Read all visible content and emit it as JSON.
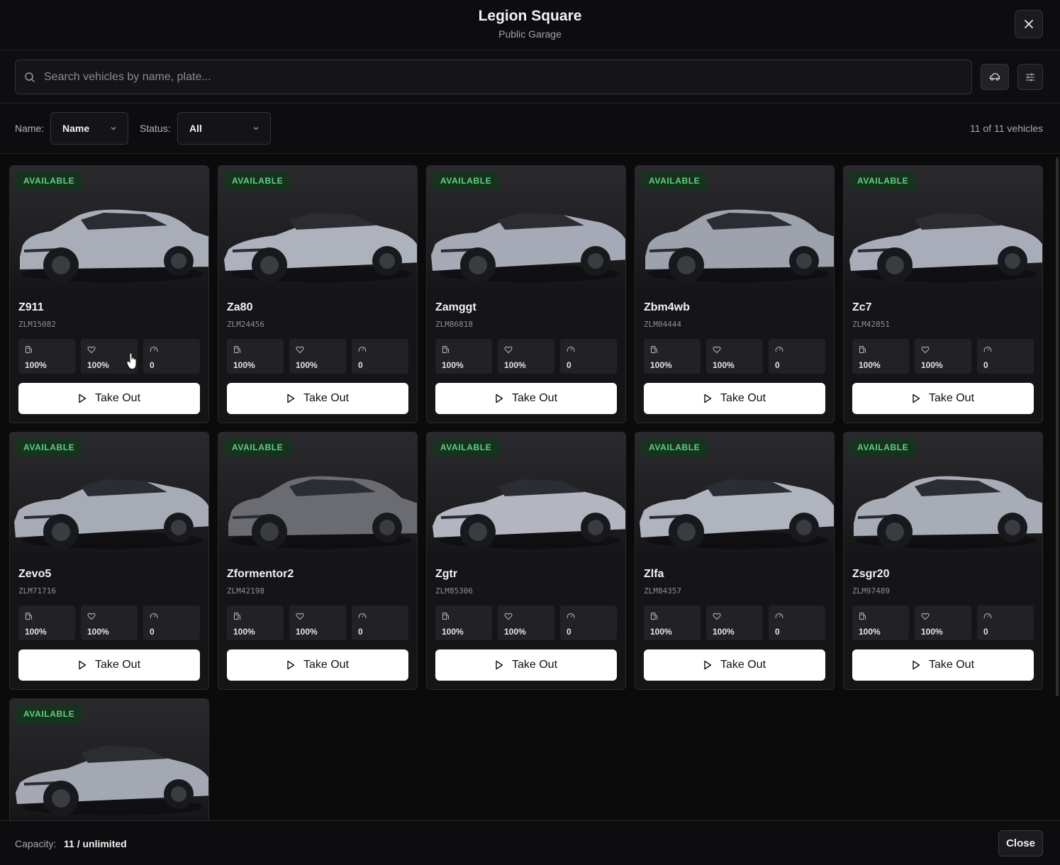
{
  "header": {
    "title": "Legion Square",
    "subtitle": "Public Garage"
  },
  "search": {
    "placeholder": "Search vehicles by name, plate..."
  },
  "filters": {
    "sort_label": "Name:",
    "sort_value": "Name",
    "status_label": "Status:",
    "status_value": "All",
    "count_text": "11 of 11 vehicles"
  },
  "vehicles": [
    {
      "name": "Z911",
      "plate": "ZLM15082",
      "status": "AVAILABLE",
      "fuel": "100%",
      "engine": "100%",
      "mileage": "0",
      "action": "Take Out",
      "paint": "#a9adb8"
    },
    {
      "name": "Za80",
      "plate": "ZLM24456",
      "status": "AVAILABLE",
      "fuel": "100%",
      "engine": "100%",
      "mileage": "0",
      "action": "Take Out",
      "paint": "#aeb2bd"
    },
    {
      "name": "Zamggt",
      "plate": "ZLM86818",
      "status": "AVAILABLE",
      "fuel": "100%",
      "engine": "100%",
      "mileage": "0",
      "action": "Take Out",
      "paint": "#a6aab6"
    },
    {
      "name": "Zbm4wb",
      "plate": "ZLM04444",
      "status": "AVAILABLE",
      "fuel": "100%",
      "engine": "100%",
      "mileage": "0",
      "action": "Take Out",
      "paint": "#9ea2ad"
    },
    {
      "name": "Zc7",
      "plate": "ZLM42851",
      "status": "AVAILABLE",
      "fuel": "100%",
      "engine": "100%",
      "mileage": "0",
      "action": "Take Out",
      "paint": "#a9adb9"
    },
    {
      "name": "Zevo5",
      "plate": "ZLM71716",
      "status": "AVAILABLE",
      "fuel": "100%",
      "engine": "100%",
      "mileage": "0",
      "action": "Take Out",
      "paint": "#a7abb6"
    },
    {
      "name": "Zformentor2",
      "plate": "ZLM42198",
      "status": "AVAILABLE",
      "fuel": "100%",
      "engine": "100%",
      "mileage": "0",
      "action": "Take Out",
      "paint": "#6a6c72"
    },
    {
      "name": "Zgtr",
      "plate": "ZLM85306",
      "status": "AVAILABLE",
      "fuel": "100%",
      "engine": "100%",
      "mileage": "0",
      "action": "Take Out",
      "paint": "#b3b6c0"
    },
    {
      "name": "Zlfa",
      "plate": "ZLM84357",
      "status": "AVAILABLE",
      "fuel": "100%",
      "engine": "100%",
      "mileage": "0",
      "action": "Take Out",
      "paint": "#b0b4be"
    },
    {
      "name": "Zsgr20",
      "plate": "ZLM97489",
      "status": "AVAILABLE",
      "fuel": "100%",
      "engine": "100%",
      "mileage": "0",
      "action": "Take Out",
      "paint": "#a8acb7"
    },
    {
      "name": "",
      "plate": "",
      "status": "AVAILABLE",
      "fuel": "",
      "engine": "",
      "mileage": "",
      "action": "",
      "paint": "#a4a8b3"
    }
  ],
  "footer": {
    "capacity_label": "Capacity:",
    "capacity_value": "11 / unlimited",
    "close_label": "Close"
  },
  "icons": {
    "close": "close-icon",
    "search": "search-icon",
    "car": "car-icon",
    "filter": "sliders-icon",
    "fuel": "fuel-icon",
    "engine": "heart-icon",
    "mileage": "gauge-icon",
    "play": "play-icon"
  },
  "colors": {
    "badge_bg": "#17331f",
    "badge_text": "#5ed27f",
    "button_bg": "#ffffff"
  }
}
